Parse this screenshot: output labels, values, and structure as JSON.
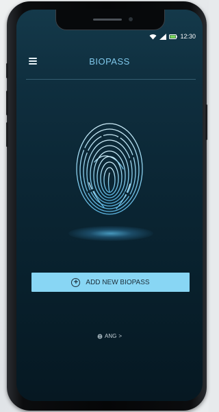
{
  "status_bar": {
    "time": "12:30",
    "icons": [
      "wifi-icon",
      "signal-icon",
      "battery-icon"
    ]
  },
  "header": {
    "title": "BIOPASS",
    "menu_icon": "hamburger-menu-icon"
  },
  "main": {
    "graphic": "fingerprint-icon",
    "add_button_label": "ADD NEW BIOPASS",
    "add_button_icon": "plus-circle-icon"
  },
  "language": {
    "label": "ANG",
    "icon": "globe-icon",
    "chevron": ">"
  },
  "colors": {
    "accent": "#88d6f4",
    "title": "#7fc7ea",
    "background": "#0b2634"
  }
}
